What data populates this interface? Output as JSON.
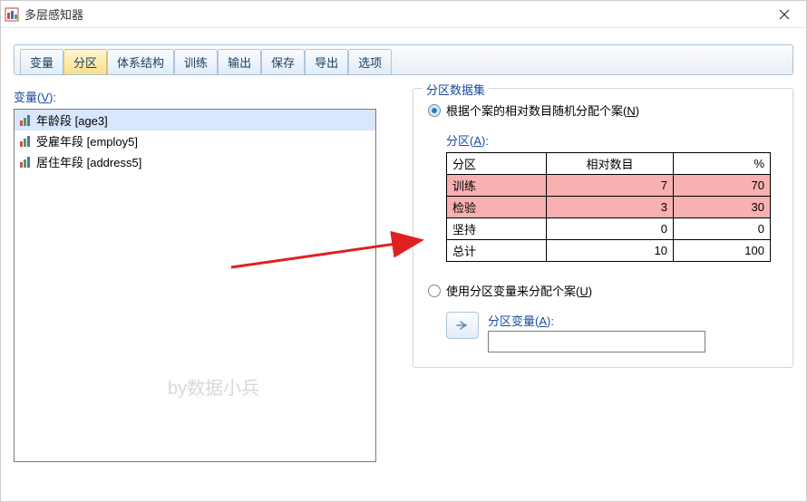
{
  "window": {
    "title": "多层感知器"
  },
  "tabs": [
    "变量",
    "分区",
    "体系结构",
    "训练",
    "输出",
    "保存",
    "导出",
    "选项"
  ],
  "active_tab_index": 1,
  "variables": {
    "label": "变量(V):",
    "label_char": "V",
    "items": [
      {
        "text": "年龄段 [age3]",
        "selected": true
      },
      {
        "text": "受雇年段 [employ5]",
        "selected": false
      },
      {
        "text": "居住年段 [address5]",
        "selected": false
      }
    ]
  },
  "watermark": "by数据小兵",
  "dataset": {
    "legend": "分区数据集",
    "radio1": "根据个案的相对数目随机分配个案(",
    "radio1_u": "N",
    "radio1_end": ")",
    "table_label": "分区(",
    "table_label_u": "A",
    "table_label_end": "):",
    "headers": {
      "partition": "分区",
      "rel": "相对数目",
      "pct": "%"
    },
    "rows": [
      {
        "partition": "训练",
        "rel": "7",
        "pct": "70",
        "pink": true
      },
      {
        "partition": "检验",
        "rel": "3",
        "pct": "30",
        "pink": true
      },
      {
        "partition": "坚持",
        "rel": "0",
        "pct": "0",
        "pink": false
      }
    ],
    "total": {
      "partition": "总计",
      "rel": "10",
      "pct": "100"
    },
    "radio2": "使用分区变量来分配个案(",
    "radio2_u": "U",
    "radio2_end": ")",
    "pv_label": "分区变量(",
    "pv_label_u": "A",
    "pv_label_end": "):"
  }
}
